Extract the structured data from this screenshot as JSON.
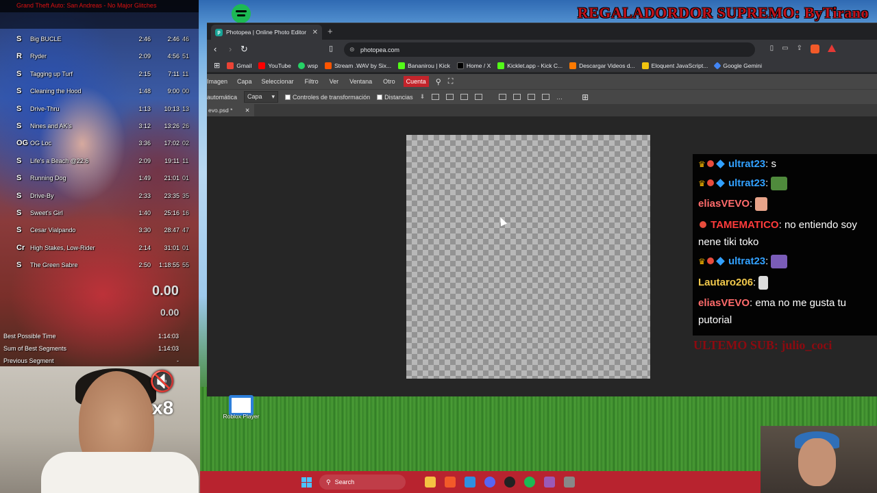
{
  "overlay": {
    "title": "REGALADORDOR SUPREMO: ByTirano",
    "last_sub": "ULTEMO SUB: julio_coci"
  },
  "browser": {
    "tab_title": "Photopea | Online Photo Editor",
    "url": "photopea.com",
    "bookmarks": [
      {
        "label": "Gmail",
        "color": "#ea4335"
      },
      {
        "label": "YouTube",
        "color": "#ff0000"
      },
      {
        "label": "wsp",
        "color": "#25d366"
      },
      {
        "label": "Stream .WAV by Six...",
        "color": "#ff5500"
      },
      {
        "label": "Bananirou | Kick",
        "color": "#53fc18"
      },
      {
        "label": "Home / X",
        "color": "#000000"
      },
      {
        "label": "Kicklet.app - Kick C...",
        "color": "#53fc18"
      },
      {
        "label": "Descargar Videos d...",
        "color": "#ff7a00"
      },
      {
        "label": "Eloquent JavaScript...",
        "color": "#f1c40f"
      },
      {
        "label": "Google Gemini",
        "color": "#4285f4"
      }
    ]
  },
  "photopea": {
    "menu": [
      "Imagen",
      "Capa",
      "Seleccionar",
      "Filtro",
      "Ver",
      "Ventana",
      "Otro"
    ],
    "menu_active": "Cuenta",
    "toolbar_auto": "automática",
    "toolbar_select": "Capa",
    "check_transform": "Controles de transformación",
    "check_distances": "Distancias",
    "doc_tab": "evo.psd *"
  },
  "chat": [
    {
      "user": "ultrat23",
      "color": "#32a1ff",
      "badges": true,
      "text": ": s",
      "emote": ""
    },
    {
      "user": "ultrat23",
      "color": "#32a1ff",
      "badges": true,
      "text": ":",
      "emote": "#4f8a3c"
    },
    {
      "user": "eliasVEVO",
      "color": "#ff6b6b",
      "badges": false,
      "text": ":",
      "emote": "#e8a48a"
    },
    {
      "user": "TAMEMATICO",
      "color": "#ff3b3b",
      "badges": false,
      "mod": true,
      "text": ": no entiendo soy nene tiki toko",
      "emote": ""
    },
    {
      "user": "ultrat23",
      "color": "#32a1ff",
      "badges": true,
      "text": ":",
      "emote": "#7a5cb8"
    },
    {
      "user": "Lautaro206",
      "color": "#f2c94c",
      "badges": false,
      "text": ":",
      "emote": "#dddddd"
    },
    {
      "user": "eliasVEVO",
      "color": "#ff6b6b",
      "badges": false,
      "text": ": ema no me gusta tu putorial",
      "emote": ""
    }
  ],
  "desktop": {
    "roblox_label": "Roblox Player",
    "search_label": "Search"
  },
  "splits": {
    "header": "Grand Theft Auto: San Andreas - No Major Glitches",
    "rows": [
      {
        "icon": "S",
        "name": "Big BUCLE",
        "delta": "2:46",
        "time": "2:46",
        "cut": "46"
      },
      {
        "icon": "R",
        "name": "Ryder",
        "delta": "2:09",
        "time": "4:56",
        "cut": "51"
      },
      {
        "icon": "S",
        "name": "Tagging up Turf",
        "delta": "2:15",
        "time": "7:11",
        "cut": "11"
      },
      {
        "icon": "S",
        "name": "Cleaning the Hood",
        "delta": "1:48",
        "time": "9:00",
        "cut": "00"
      },
      {
        "icon": "S",
        "name": "Drive-Thru",
        "delta": "1:13",
        "time": "10:13",
        "cut": "13"
      },
      {
        "icon": "S",
        "name": "Nines and AK's",
        "delta": "3:12",
        "time": "13:26",
        "cut": "26"
      },
      {
        "icon": "OG",
        "name": "OG Loc",
        "delta": "3:36",
        "time": "17:02",
        "cut": "02"
      },
      {
        "icon": "S",
        "name": "Life's a Beach @22:6",
        "delta": "2:09",
        "time": "19:11",
        "cut": "11"
      },
      {
        "icon": "S",
        "name": "Running Dog",
        "delta": "1:49",
        "time": "21:01",
        "cut": "01"
      },
      {
        "icon": "S",
        "name": "Drive-By",
        "delta": "2:33",
        "time": "23:35",
        "cut": "35"
      },
      {
        "icon": "S",
        "name": "Sweet's Girl",
        "delta": "1:40",
        "time": "25:16",
        "cut": "16"
      },
      {
        "icon": "S",
        "name": "Cesar Vialpando",
        "delta": "3:30",
        "time": "28:47",
        "cut": "47"
      },
      {
        "icon": "Cr",
        "name": "High Stakes, Low-Rider",
        "delta": "2:14",
        "time": "31:01",
        "cut": "01"
      },
      {
        "icon": "S",
        "name": "The Green Sabre",
        "delta": "2:50",
        "time": "1:18:55",
        "cut": "55"
      }
    ],
    "timer": "0.00",
    "timer_sub": "0.00",
    "best_possible_label": "Best Possible Time",
    "best_possible_value": "1:14:03",
    "sum_best_label": "Sum of Best Segments",
    "sum_best_value": "1:14:03",
    "prev_segment_label": "Previous Segment",
    "prev_segment_value": "-"
  },
  "webcam": {
    "mute_count": "x8"
  }
}
